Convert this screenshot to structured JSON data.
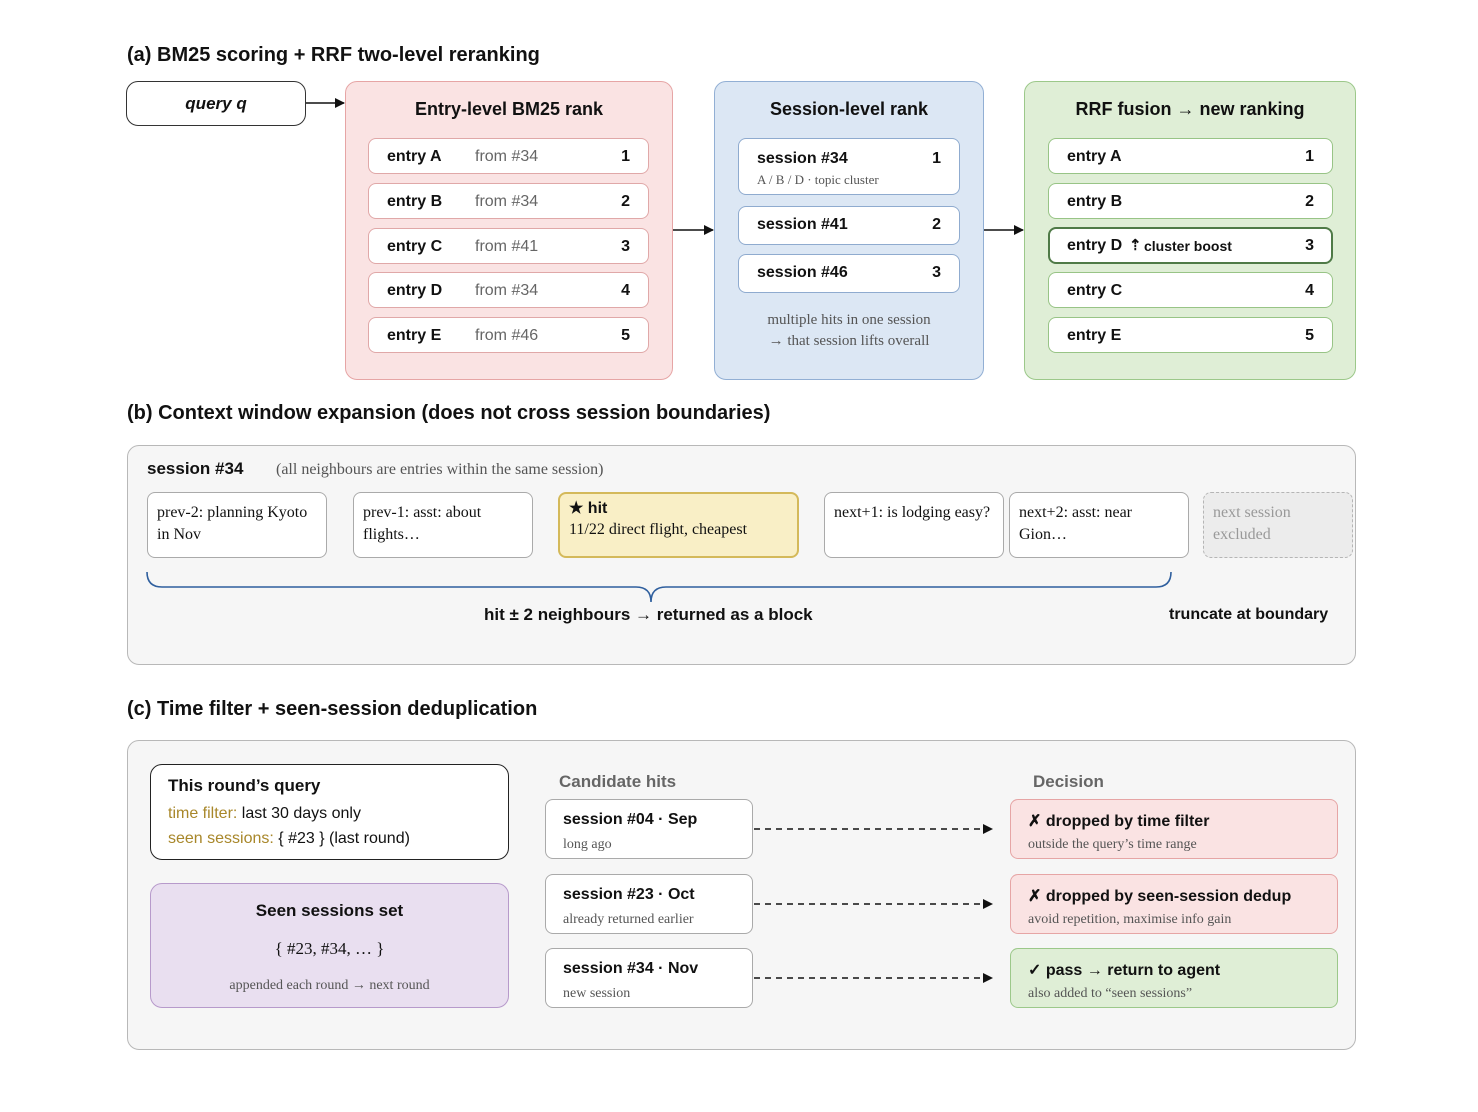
{
  "section_a": {
    "title": "(a) BM25 scoring + RRF two-level reranking",
    "query": "query q",
    "entry_panel": {
      "title": "Entry-level BM25 rank",
      "rows": [
        {
          "name": "entry A",
          "from": "from #34",
          "rank": "1"
        },
        {
          "name": "entry B",
          "from": "from #34",
          "rank": "2"
        },
        {
          "name": "entry C",
          "from": "from #41",
          "rank": "3"
        },
        {
          "name": "entry D",
          "from": "from #34",
          "rank": "4"
        },
        {
          "name": "entry E",
          "from": "from #46",
          "rank": "5"
        }
      ]
    },
    "session_panel": {
      "title": "Session-level rank",
      "rows": [
        {
          "name": "session #34",
          "rank": "1",
          "sub": "A / B / D · topic cluster"
        },
        {
          "name": "session #41",
          "rank": "2"
        },
        {
          "name": "session #46",
          "rank": "3"
        }
      ],
      "note_line1": "multiple hits in one session",
      "note_line2": "→ that session lifts overall"
    },
    "rrf_panel": {
      "title": "RRF fusion → new ranking",
      "rows": [
        {
          "name": "entry A",
          "rank": "1"
        },
        {
          "name": "entry B",
          "rank": "2"
        },
        {
          "name": "entry D",
          "boost_arrow": "⇡",
          "boost_label": "cluster boost",
          "rank": "3"
        },
        {
          "name": "entry C",
          "rank": "4"
        },
        {
          "name": "entry E",
          "rank": "5"
        }
      ]
    }
  },
  "section_b": {
    "title": "(b) Context window expansion (does not cross session boundaries)",
    "session_label": "session #34",
    "session_note": "(all neighbours are entries within the same session)",
    "cards": [
      {
        "text": "prev-2: planning Kyoto in Nov"
      },
      {
        "text": "prev-1: asst: about flights…"
      },
      {
        "star": "★",
        "title": "hit",
        "text": "11/22 direct flight, cheapest"
      },
      {
        "text": "next+1: is lodging easy?"
      },
      {
        "text": "next+2: asst: near Gion…"
      },
      {
        "text": "next session excluded"
      }
    ],
    "brace_label": "hit ± 2 neighbours → returned as a block",
    "boundary_label": "truncate at boundary"
  },
  "section_c": {
    "title": "(c) Time filter + seen-session deduplication",
    "query_box": {
      "title": "This round’s query",
      "filter_key": "time filter:",
      "filter_val": " last 30 days only",
      "seen_key": "seen sessions:",
      "seen_val": " { #23 } (last round)"
    },
    "seen_set": {
      "title": "Seen sessions set",
      "value": "{ #23, #34, … }",
      "note": "appended each round → next round"
    },
    "candidates_header": "Candidate hits",
    "decision_header": "Decision",
    "candidates": [
      {
        "title": "session #04 · Sep",
        "sub": "long ago"
      },
      {
        "title": "session #23 · Oct",
        "sub": "already returned earlier"
      },
      {
        "title": "session #34 · Nov",
        "sub": "new session"
      }
    ],
    "decisions": [
      {
        "title": "✗ dropped by time filter",
        "sub": "outside the query’s time range"
      },
      {
        "title": "✗ dropped by seen-session dedup",
        "sub": "avoid repetition, maximise info gain"
      },
      {
        "title": "✓ pass → return to agent",
        "sub": "also added to “seen sessions”"
      }
    ]
  },
  "colors": {
    "entry_panel_bg": "#fae3e3",
    "entry_panel_border": "#e6a5a5",
    "session_panel_bg": "#dce7f4",
    "session_panel_border": "#92afd4",
    "rrf_panel_bg": "#dfeed6",
    "rrf_panel_border": "#9cc88a",
    "hit_bg": "#f9efc6",
    "hit_border": "#d4b95a",
    "seen_bg": "#e9dff0",
    "seen_border": "#b79acb",
    "drop_bg": "#fae3e3",
    "drop_border": "#e6a5a5",
    "pass_bg": "#dfeed6",
    "pass_border": "#9cc88a",
    "accent_gold": "#a8872a",
    "brace": "#2f5f9e"
  }
}
